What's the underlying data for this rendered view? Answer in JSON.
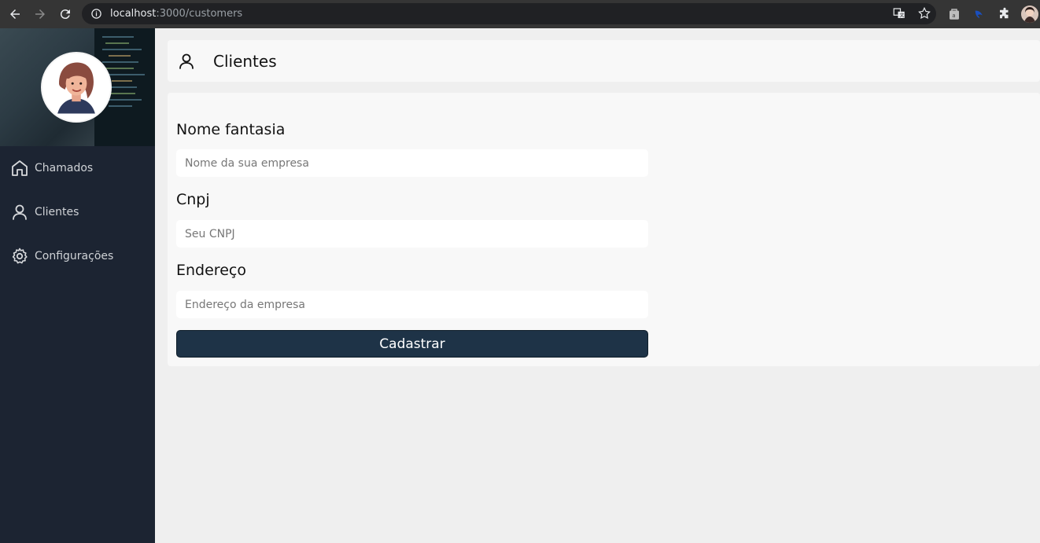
{
  "browser": {
    "url_host": "localhost",
    "url_path": ":3000/customers"
  },
  "sidebar": {
    "items": [
      {
        "label": "Chamados",
        "icon": "home-icon"
      },
      {
        "label": "Clientes",
        "icon": "user-icon"
      },
      {
        "label": "Configurações",
        "icon": "gear-icon"
      }
    ]
  },
  "header": {
    "title": "Clientes",
    "icon": "user-icon"
  },
  "form": {
    "fields": [
      {
        "label": "Nome fantasia",
        "placeholder": "Nome da sua empresa",
        "value": ""
      },
      {
        "label": "Cnpj",
        "placeholder": "Seu CNPJ",
        "value": ""
      },
      {
        "label": "Endereço",
        "placeholder": "Endereço da empresa",
        "value": ""
      }
    ],
    "submit_label": "Cadastrar"
  },
  "colors": {
    "sidebar_bg": "#1c2432",
    "button_bg": "#1e3347",
    "page_bg": "#efefef",
    "card_bg": "#f8f8f8"
  }
}
